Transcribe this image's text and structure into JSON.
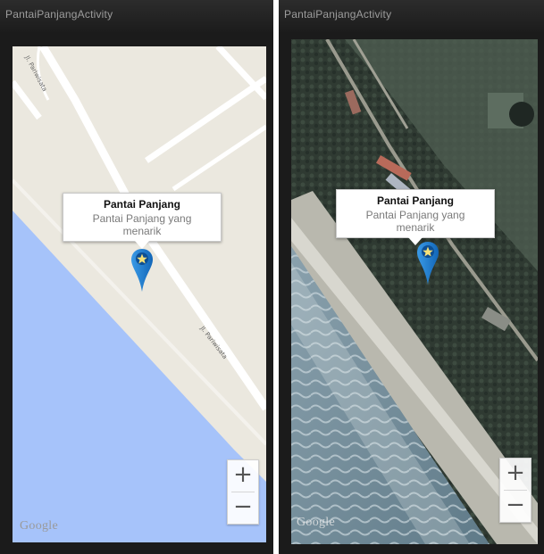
{
  "screens": [
    {
      "id": "roadmap",
      "title": "PantaiPanjangActivity",
      "info_window": {
        "title": "Pantai Panjang",
        "snippet": "Pantai Panjang yang menarik"
      },
      "road_labels": [
        "Jl. Pariwisata",
        "Jl. Pariwisata"
      ],
      "zoom_in_label": "+",
      "zoom_out_label": "−",
      "map_logo": "Google",
      "marker_icon": "star-map-marker-icon"
    },
    {
      "id": "satellite",
      "title": "PantaiPanjangActivity",
      "info_window": {
        "title": "Pantai Panjang",
        "snippet": "Pantai Panjang yang menarik"
      },
      "zoom_in_label": "+",
      "zoom_out_label": "−",
      "map_logo": "Google",
      "marker_icon": "star-map-marker-icon"
    }
  ],
  "colors": {
    "land": "#ebe8df",
    "water": "#a6c3fa",
    "road": "#ffffff",
    "marker": "#1e7fd0",
    "titlebar": "#222222"
  }
}
